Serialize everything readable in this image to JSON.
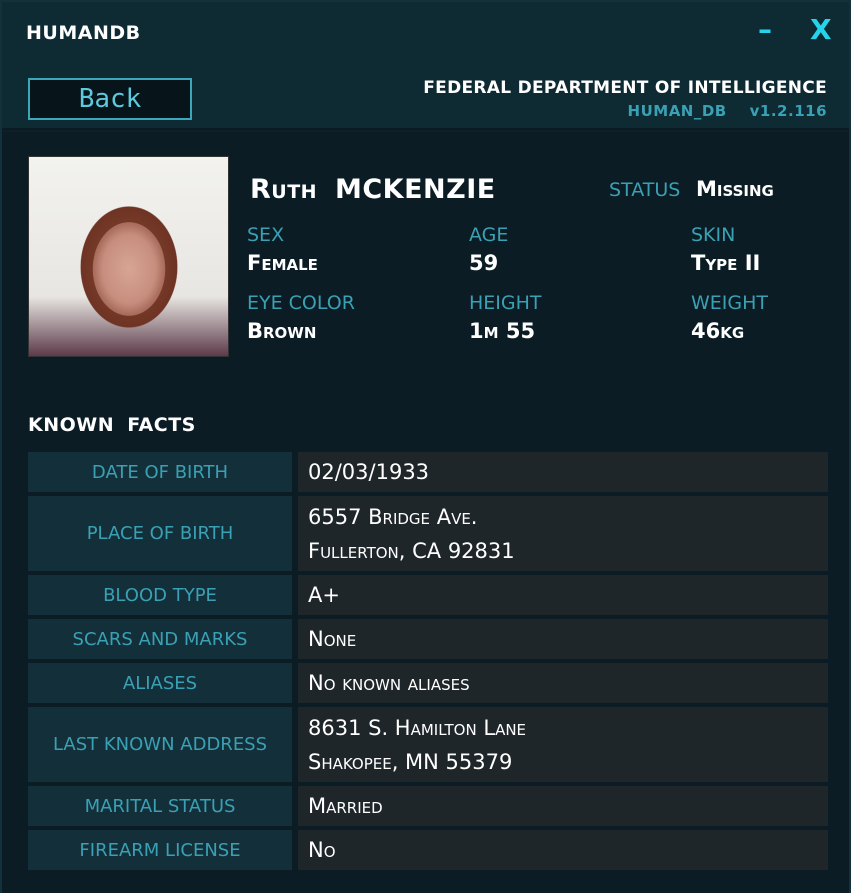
{
  "app": {
    "title": "HUMANDB"
  },
  "window_controls": {
    "minimize": "–",
    "close": "X"
  },
  "header": {
    "back_label": "Back",
    "agency": "FEDERAL DEPARTMENT OF INTELLIGENCE",
    "db_name": "HUMAN_DB",
    "version": "v1.2.116"
  },
  "profile": {
    "first_name": "Ruth",
    "last_name": "MCKENZIE",
    "status_label": "STATUS",
    "status": "Missing",
    "fields": {
      "sex": {
        "label": "SEX",
        "value": "Female"
      },
      "age": {
        "label": "AGE",
        "value": "59"
      },
      "skin": {
        "label": "SKIN",
        "value": "Type II"
      },
      "eye_color": {
        "label": "EYE COLOR",
        "value": "Brown"
      },
      "height": {
        "label": "HEIGHT",
        "value": "1m 55"
      },
      "weight": {
        "label": "WEIGHT",
        "value": "46kg"
      }
    }
  },
  "facts": {
    "title": "KNOWN  FACTS",
    "rows": [
      {
        "label": "DATE OF BIRTH",
        "lines": [
          "02/03/1933"
        ]
      },
      {
        "label": "PLACE OF BIRTH",
        "lines": [
          "6557 Bridge Ave.",
          "Fullerton, CA 92831"
        ]
      },
      {
        "label": "BLOOD TYPE",
        "lines": [
          "A+"
        ]
      },
      {
        "label": "SCARS AND MARKS",
        "lines": [
          "None"
        ]
      },
      {
        "label": "ALIASES",
        "lines": [
          "No known aliases"
        ]
      },
      {
        "label": "LAST KNOWN ADDRESS",
        "lines": [
          "8631 S. Hamilton Lane",
          "Shakopee, MN 55379"
        ]
      },
      {
        "label": "MARITAL STATUS",
        "lines": [
          "Married"
        ]
      },
      {
        "label": "FIREARM LICENSE",
        "lines": [
          "No"
        ]
      }
    ]
  },
  "colors": {
    "accent": "#25d4ea",
    "label": "#3aa0b4",
    "background": "#0b1c24"
  }
}
